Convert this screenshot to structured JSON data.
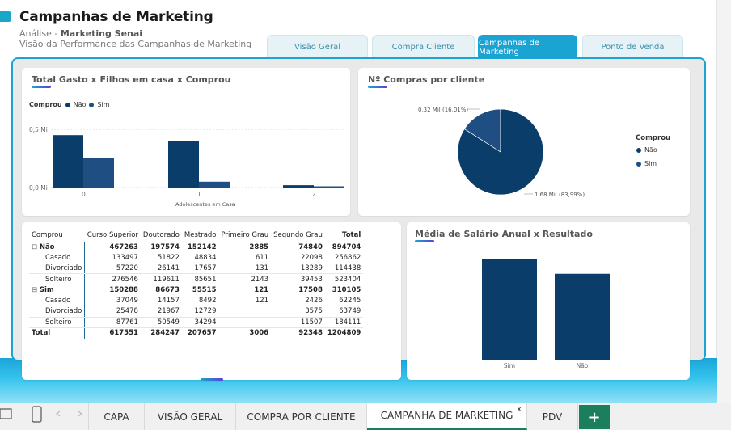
{
  "header": {
    "title": "Campanhas de Marketing",
    "subtitle_prefix": "Análise - ",
    "subtitle_bold": "Marketing Senai",
    "subtitle2": "Visão da Performance das Campanhas de Marketing"
  },
  "tabs": [
    {
      "label": "Visão Geral",
      "active": false
    },
    {
      "label": "Compra  Cliente",
      "active": false
    },
    {
      "label": "Campanhas de Marketing",
      "active": true
    },
    {
      "label": "Ponto de Venda",
      "active": false
    }
  ],
  "colors": {
    "accent": "#1ba3d4",
    "nao": "#0b3d6b",
    "sim": "#1f4e82",
    "sheet_active": "#1b7f5e"
  },
  "chart1": {
    "title": "Total Gasto x Filhos em casa x Comprou",
    "legend_title": "Comprou",
    "legend_nao": "Não",
    "legend_sim": "Sim",
    "y_top": "0,5 Mi",
    "y_bottom": "0,0 Mi",
    "xlabel": "Adolescentes em Casa"
  },
  "chart2": {
    "title": "Nº Compras por cliente",
    "legend_title": "Comprou",
    "legend_nao": "Não",
    "legend_sim": "Sim",
    "label_sim": "0,32 Mil (16,01%)",
    "label_nao": "1,68 Mil (83,99%)"
  },
  "chart3": {
    "title": "Média de Salário Anual x Resultado"
  },
  "chart_data": [
    {
      "type": "bar",
      "title": "Total Gasto x Filhos em casa x Comprou",
      "xlabel": "Adolescentes em Casa",
      "categories": [
        "0",
        "1",
        "2"
      ],
      "series": [
        {
          "name": "Não",
          "values": [
            0.45,
            0.4,
            0.02
          ]
        },
        {
          "name": "Sim",
          "values": [
            0.25,
            0.05,
            0.005
          ]
        }
      ],
      "ylim": [
        0,
        0.5
      ],
      "legend": "top-left"
    },
    {
      "type": "pie",
      "title": "Nº Compras por cliente",
      "categories": [
        "Não",
        "Sim"
      ],
      "values": [
        1.68,
        0.32
      ],
      "legend": "right"
    },
    {
      "type": "bar",
      "title": "Média de Salário Anual x Resultado",
      "categories": [
        "Sim",
        "Não"
      ],
      "values": [
        1.0,
        0.85
      ]
    }
  ],
  "table": {
    "headers": [
      "Comprou",
      "Curso Superior",
      "Doutorado",
      "Mestrado",
      "Primeiro Grau",
      "Segundo Grau",
      "Total"
    ],
    "rows": [
      {
        "kind": "grp",
        "cells": [
          "Não",
          "467263",
          "197574",
          "152142",
          "2885",
          "74840",
          "894704"
        ]
      },
      {
        "kind": "row",
        "cells": [
          "Casado",
          "133497",
          "51822",
          "48834",
          "611",
          "22098",
          "256862"
        ]
      },
      {
        "kind": "row",
        "cells": [
          "Divorciado",
          "57220",
          "26141",
          "17657",
          "131",
          "13289",
          "114438"
        ]
      },
      {
        "kind": "row",
        "cells": [
          "Solteiro",
          "276546",
          "119611",
          "85651",
          "2143",
          "39453",
          "523404"
        ]
      },
      {
        "kind": "grp",
        "cells": [
          "Sim",
          "150288",
          "86673",
          "55515",
          "121",
          "17508",
          "310105"
        ]
      },
      {
        "kind": "row",
        "cells": [
          "Casado",
          "37049",
          "14157",
          "8492",
          "121",
          "2426",
          "62245"
        ]
      },
      {
        "kind": "row",
        "cells": [
          "Divorciado",
          "25478",
          "21967",
          "12729",
          "",
          "3575",
          "63749"
        ]
      },
      {
        "kind": "row",
        "cells": [
          "Solteiro",
          "87761",
          "50549",
          "34294",
          "",
          "11507",
          "184111"
        ]
      },
      {
        "kind": "total",
        "cells": [
          "Total",
          "617551",
          "284247",
          "207657",
          "3006",
          "92348",
          "1204809"
        ]
      }
    ]
  },
  "sheets": [
    {
      "label": "CAPA",
      "active": false
    },
    {
      "label": "VISÃO GERAL",
      "active": false
    },
    {
      "label": "COMPRA POR CLIENTE",
      "active": false
    },
    {
      "label": "CAMPANHA DE MARKETING",
      "active": true
    },
    {
      "label": "PDV",
      "active": false
    }
  ],
  "sheet_close": "x",
  "sheet_add": "+"
}
